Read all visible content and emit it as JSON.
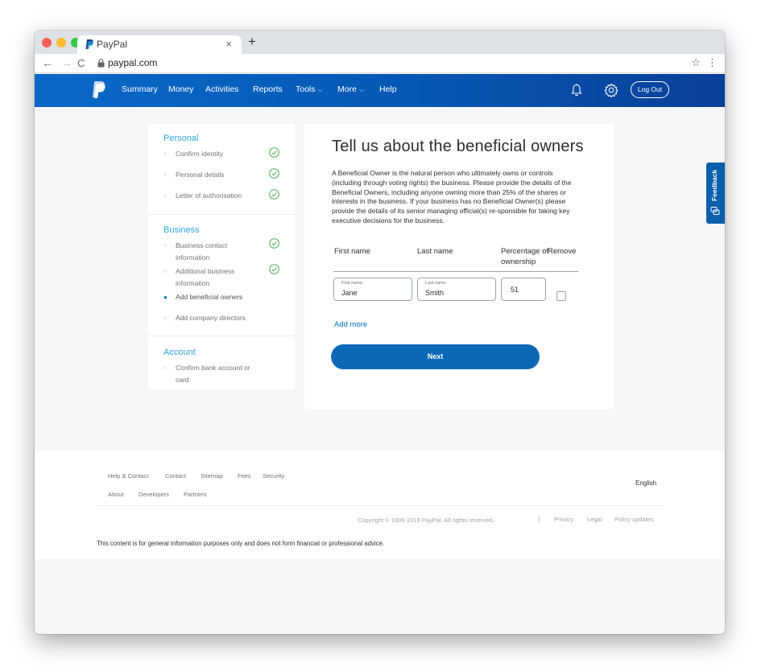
{
  "browser": {
    "tab_title": "PayPal",
    "tab_close": "×",
    "new_tab": "+",
    "url": "paypal.com",
    "back": "←",
    "forward": "→",
    "reload": "C",
    "star": "☆",
    "menu": "⋮"
  },
  "nav": {
    "items": [
      {
        "label": "Summary"
      },
      {
        "label": "Money"
      },
      {
        "label": "Activities"
      },
      {
        "label": "Reports"
      },
      {
        "label": "Tools",
        "chevron": "⌵"
      },
      {
        "label": "More",
        "chevron": "⌵"
      },
      {
        "label": "Help"
      }
    ],
    "logout_label": "Log Out"
  },
  "sidebar": {
    "sections": [
      {
        "title": "Personal",
        "items": [
          {
            "label": "Confirm identity",
            "done": true
          },
          {
            "label": "Personal details",
            "done": true
          },
          {
            "label": "Letter of authorisation",
            "done": true
          }
        ]
      },
      {
        "title": "Business",
        "items": [
          {
            "label": "Business contact information",
            "done": true
          },
          {
            "label": "Additional business information",
            "done": true
          },
          {
            "label": "Add beneficial owners",
            "active": true
          },
          {
            "label": "Add company directors"
          }
        ]
      },
      {
        "title": "Account",
        "items": [
          {
            "label": "Confirm bank account or card"
          }
        ]
      }
    ]
  },
  "main": {
    "title": "Tell us about the beneficial owners",
    "description": "A Beneficial Owner is the natural person who ultimately owns or controls (including through voting rights) the business. Please provide the details of the Beneficial Owners, including anyone owning more than 25% of the shares or interests in the business. If your business has no Beneficial Owner(s) please provide the details of its senior managing official(s) re-sponsible for taking key executive decisions for the business.",
    "columns": {
      "first_name": "First name",
      "last_name": "Last name",
      "percentage": "Percentage of ownership",
      "remove": "Remove"
    },
    "row": {
      "first_name_label": "First name",
      "first_name_value": "Jane",
      "last_name_label": "Last name",
      "last_name_value": "Smith",
      "percentage_value": "51",
      "remove_checked": false
    },
    "add_more": "Add more",
    "next_label": "Next"
  },
  "feedback": {
    "label": "Feedback"
  },
  "footer": {
    "links_row1": [
      "Help & Contact",
      "Contact",
      "Sitemap",
      "Fees",
      "Security"
    ],
    "links_row2": [
      "About",
      "Developers",
      "Partners"
    ],
    "language": "English",
    "copyright": "Copyright © 1999-2019 PayPal. All rights reserved.",
    "separator": "|",
    "legal_links": [
      "Privacy",
      "Legal",
      "Policy updates"
    ],
    "disclaimer": "This content is for general information purposes only and does not form financial or professional advice."
  },
  "colors": {
    "brand_blue": "#0070ba",
    "header_gradient_start": "#0a69c8",
    "header_gradient_end": "#0a3f9a",
    "section_title": "#2ba6e1",
    "check_green": "#4caf50"
  }
}
